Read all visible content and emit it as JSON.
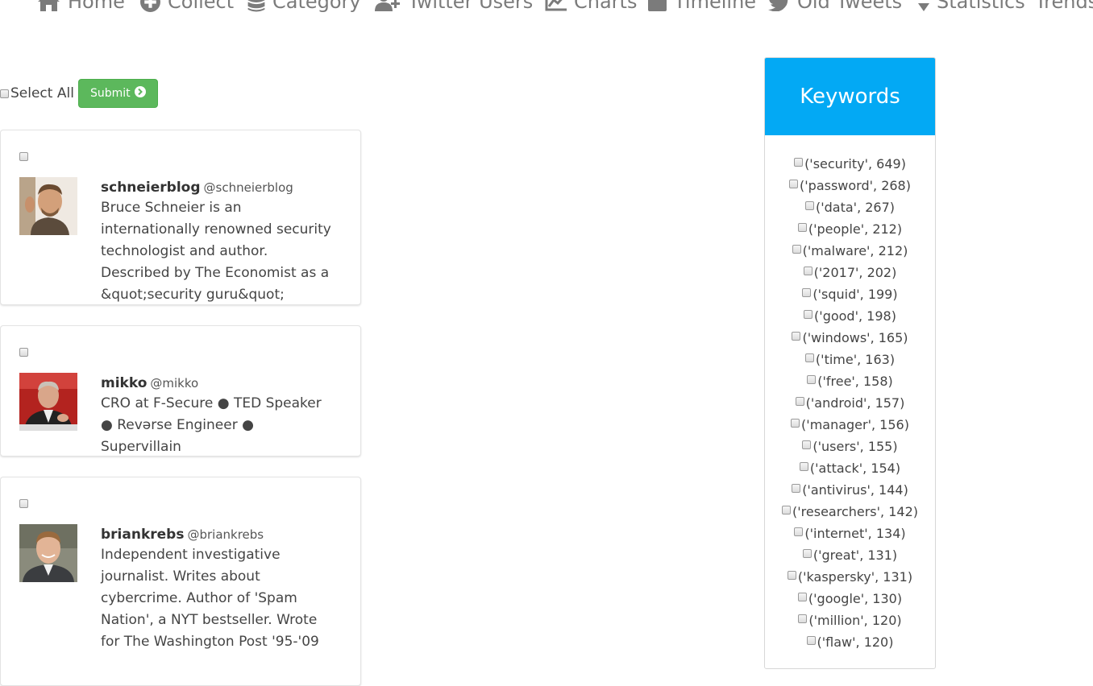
{
  "nav": {
    "items": [
      {
        "label": "Home",
        "icon": "home-icon"
      },
      {
        "label": "Collect",
        "icon": "plus-circle-icon"
      },
      {
        "label": "Category",
        "icon": "database-icon"
      },
      {
        "label": "Twitter Users",
        "icon": "user-plus-icon"
      },
      {
        "label": "Charts",
        "icon": "line-chart-icon"
      },
      {
        "label": "Timeline",
        "icon": "calendar-icon"
      },
      {
        "label": "Old Tweets",
        "icon": "twitter-icon"
      },
      {
        "label": "Statistics",
        "icon": "sort-icon"
      },
      {
        "label": "Trends",
        "icon": ""
      }
    ]
  },
  "controls": {
    "select_all_label": "Select All",
    "submit_label": "Submit"
  },
  "users": [
    {
      "username": "schneierblog",
      "handle": "@schneierblog",
      "bio": "Bruce Schneier is an internationally renowned security technologist and author. Described by The Economist as a &quot;security guru&quot;"
    },
    {
      "username": "mikko",
      "handle": "@mikko",
      "bio": "CRO at F-Secure ● TED Speaker ● Revǝrse Engineer ● Supervillain"
    },
    {
      "username": "briankrebs",
      "handle": "@briankrebs",
      "bio": "Independent investigative journalist. Writes about cybercrime. Author of 'Spam Nation', a NYT bestseller. Wrote for The Washington Post '95-'09"
    }
  ],
  "keywords": {
    "title": "Keywords",
    "items": [
      "('security', 649)",
      "('password', 268)",
      "('data', 267)",
      "('people', 212)",
      "('malware', 212)",
      "('2017', 202)",
      "('squid', 199)",
      "('good', 198)",
      "('windows', 165)",
      "('time', 163)",
      "('free', 158)",
      "('android', 157)",
      "('manager', 156)",
      "('users', 155)",
      "('attack', 154)",
      "('antivirus', 144)",
      "('researchers', 142)",
      "('internet', 134)",
      "('great', 131)",
      "('kaspersky', 131)",
      "('google', 130)",
      "('million', 120)",
      "('flaw', 120)"
    ]
  },
  "colors": {
    "nav_text": "#7b7b7b",
    "submit_bg": "#5cb85c",
    "keywords_header_bg": "#03a9f4"
  }
}
